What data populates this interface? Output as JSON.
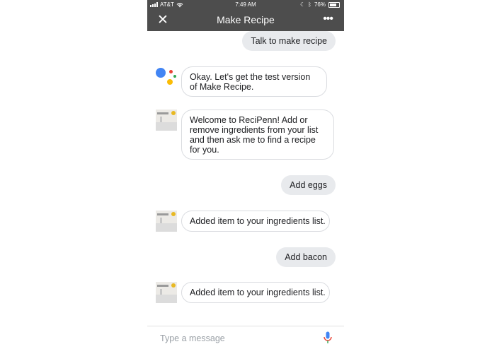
{
  "status_bar": {
    "carrier": "AT&T",
    "time": "7:49 AM",
    "battery": "76%"
  },
  "app_bar": {
    "title": "Make Recipe",
    "close_icon": "close-icon",
    "more_icon": "more-horizontal-icon"
  },
  "conversation": [
    {
      "role": "user",
      "text": "Talk to make recipe"
    },
    {
      "role": "assistant",
      "avatar": "google-assistant-logo",
      "text": "Okay. Let's get the test version of Make Recipe."
    },
    {
      "role": "app",
      "avatar": "app-avatar-image",
      "text": "Welcome to ReciPenn! Add or remove ingredients from your list and then ask me to find a recipe for you."
    },
    {
      "role": "user",
      "text": "Add eggs"
    },
    {
      "role": "app",
      "avatar": "app-avatar-image",
      "text": "Added item to your ingredients list."
    },
    {
      "role": "user",
      "text": "Add bacon"
    },
    {
      "role": "app",
      "avatar": "app-avatar-image",
      "text": "Added item to your ingredients list."
    }
  ],
  "composer": {
    "placeholder": "Type a message",
    "value": "",
    "mic_icon": "microphone-icon"
  },
  "colors": {
    "header_bg": "#4d4d4d",
    "user_bubble": "#e8eaed",
    "bot_bubble_border": "#dadce0",
    "mic_blue": "#4285f4",
    "mic_red": "#ea4335",
    "logo_blue": "#4285f4",
    "logo_red": "#ea4335",
    "logo_yellow": "#fbbc05",
    "logo_green": "#34a853"
  }
}
